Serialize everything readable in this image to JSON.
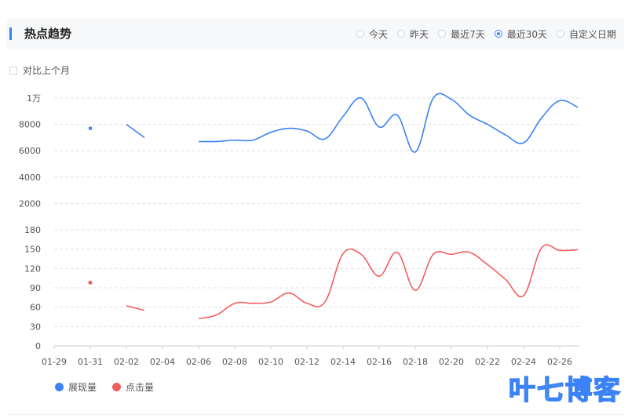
{
  "header": {
    "title": "热点趋势",
    "ranges": [
      {
        "label": "今天",
        "selected": false
      },
      {
        "label": "昨天",
        "selected": false
      },
      {
        "label": "最近7天",
        "selected": false
      },
      {
        "label": "最近30天",
        "selected": true
      },
      {
        "label": "自定义日期",
        "selected": false
      }
    ]
  },
  "compare_label": "对比上个月",
  "watermark": "叶七博客",
  "colors": {
    "impressions": "#3b82f6",
    "clicks": "#f25e5e",
    "accent": "#3b82f6"
  },
  "chart_data": [
    {
      "type": "line",
      "x": [
        "01-29",
        "01-30",
        "01-31",
        "02-01",
        "02-02",
        "02-03",
        "02-04",
        "02-05",
        "02-06",
        "02-07",
        "02-08",
        "02-09",
        "02-10",
        "02-11",
        "02-12",
        "02-13",
        "02-14",
        "02-15",
        "02-16",
        "02-17",
        "02-18",
        "02-19",
        "02-20",
        "02-21",
        "02-22",
        "02-23",
        "02-24",
        "02-25",
        "02-26",
        "02-27"
      ],
      "series": [
        {
          "name": "展现量",
          "values": [
            null,
            null,
            7700,
            null,
            8000,
            7000,
            null,
            null,
            6700,
            6700,
            6800,
            6800,
            7400,
            7700,
            7500,
            6900,
            8600,
            10000,
            7800,
            8700,
            5900,
            10000,
            9900,
            8700,
            8000,
            7200,
            6600,
            8500,
            9800,
            9300
          ]
        }
      ],
      "yticks": [
        "1万",
        "8000",
        "6000",
        "4000",
        "2000"
      ],
      "ylim": [
        0,
        10000
      ]
    },
    {
      "type": "line",
      "x": [
        "01-29",
        "01-30",
        "01-31",
        "02-01",
        "02-02",
        "02-03",
        "02-04",
        "02-05",
        "02-06",
        "02-07",
        "02-08",
        "02-09",
        "02-10",
        "02-11",
        "02-12",
        "02-13",
        "02-14",
        "02-15",
        "02-16",
        "02-17",
        "02-18",
        "02-19",
        "02-20",
        "02-21",
        "02-22",
        "02-23",
        "02-24",
        "02-25",
        "02-26",
        "02-27"
      ],
      "xticks": [
        "01-29",
        "01-31",
        "02-02",
        "02-04",
        "02-06",
        "02-08",
        "02-10",
        "02-12",
        "02-14",
        "02-16",
        "02-18",
        "02-20",
        "02-22",
        "02-24",
        "02-26"
      ],
      "series": [
        {
          "name": "点击量",
          "values": [
            null,
            null,
            98,
            null,
            62,
            55,
            null,
            null,
            42,
            48,
            66,
            66,
            68,
            82,
            66,
            68,
            143,
            142,
            108,
            145,
            86,
            142,
            142,
            145,
            126,
            103,
            78,
            152,
            148,
            149
          ]
        }
      ],
      "yticks": [
        "180",
        "150",
        "120",
        "90",
        "60",
        "30",
        "0"
      ],
      "ylim": [
        0,
        180
      ]
    }
  ]
}
